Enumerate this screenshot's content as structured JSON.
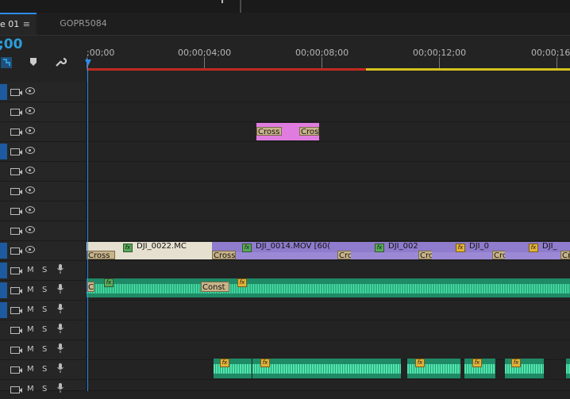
{
  "tabs": [
    {
      "label": "e 01",
      "menu": "≡"
    },
    {
      "label": "GOPR5084"
    }
  ],
  "timecode": ";00",
  "ruler": {
    "labels": [
      ";00;00",
      "00;00;04;00",
      "00;00;08;00",
      "00;00;12;00",
      "00;00;16"
    ]
  },
  "tracks": {
    "video_icons": [
      "film-icon",
      "eye-icon"
    ],
    "audio_letters": {
      "mute": "M",
      "solo": "S",
      "mic": "🎙"
    }
  },
  "clips": {
    "pink_cross_1": "Cross",
    "pink_cross_2": "Cros",
    "v1_cross_1": "Cross",
    "v1_title_1": "DJI_0022.MC",
    "v1_cross_2": "Cross Dis",
    "v1_title_2": "DJI_0014.MOV [60(",
    "v1_cross_3": "Cross",
    "v1_title_3": "DJI_002",
    "v1_cross_4": "Cross",
    "v1_title_4": "DJI_0",
    "v1_cross_5": "Cross",
    "v1_title_5": "DJI_",
    "a1_cross_1": "C",
    "a1_cross_2": "Const",
    "fx": "fx"
  },
  "colors": {
    "accent": "#2d8ceb",
    "video_clip": "#8f7ccc",
    "audio_clip": "#1e8a66",
    "pink_clip": "#e07ce0",
    "work_area_red": "#c0291f",
    "work_area_yellow": "#d6c21d"
  }
}
